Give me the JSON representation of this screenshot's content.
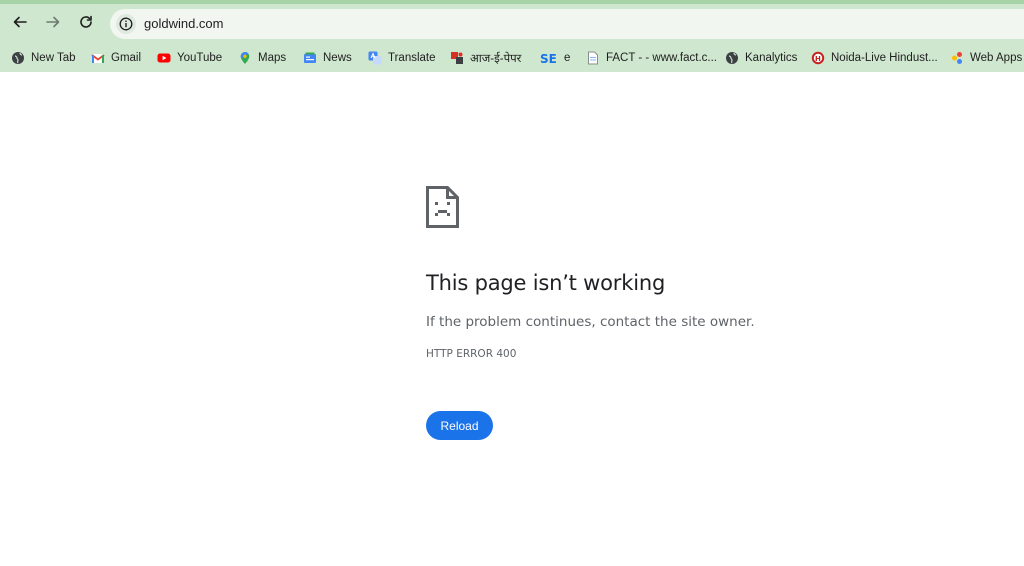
{
  "browser": {
    "url": "goldwind.com",
    "back_label": "Back",
    "forward_label": "Forward",
    "reload_label": "Reload page",
    "bookmarks": [
      {
        "label": "New Tab",
        "icon": "globe-icon"
      },
      {
        "label": "Gmail",
        "icon": "gmail-icon"
      },
      {
        "label": "YouTube",
        "icon": "youtube-icon"
      },
      {
        "label": "Maps",
        "icon": "maps-pin-icon"
      },
      {
        "label": "News",
        "icon": "news-icon"
      },
      {
        "label": "Translate",
        "icon": "translate-icon"
      },
      {
        "label": "आज-ई-पेपर",
        "icon": "aaj-epaper-icon"
      },
      {
        "label": "e",
        "icon": "se-icon"
      },
      {
        "label": "FACT - - www.fact.c...",
        "icon": "document-icon"
      },
      {
        "label": "Kanalytics",
        "icon": "globe-icon"
      },
      {
        "label": "Noida-Live Hindust...",
        "icon": "hindustan-icon"
      },
      {
        "label": "Web Apps I",
        "icon": "web-apps-icon"
      }
    ],
    "colors": {
      "chrome_bg": "#cfe7cf",
      "omnibox_bg": "#f1f6f1"
    }
  },
  "error_page": {
    "icon": "sad-document-icon",
    "title": "This page isn’t working",
    "description": "If the problem continues, contact the site owner.",
    "error_code": "HTTP ERROR 400",
    "reload_button": "Reload",
    "accent_color": "#1a73e8"
  }
}
